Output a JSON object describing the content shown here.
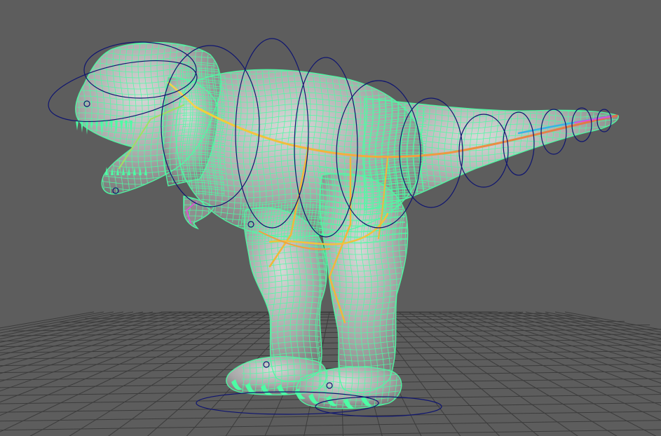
{
  "viewport": {
    "background": "#5d5d5d",
    "grid_color": "#3c3c3c",
    "wire_color": "#4dfca4",
    "control_curve_color": "#0f1570",
    "skin_color": "#a9a9a9"
  },
  "scene": {
    "objects": [
      {
        "name": "grid",
        "icon": "grid-floor-icon"
      },
      {
        "name": "trex-mesh",
        "icon": "mesh-icon"
      },
      {
        "name": "skeleton",
        "icon": "joint-chain-icon"
      },
      {
        "name": "control-curves",
        "icon": "nurbs-circle-icon"
      }
    ]
  }
}
